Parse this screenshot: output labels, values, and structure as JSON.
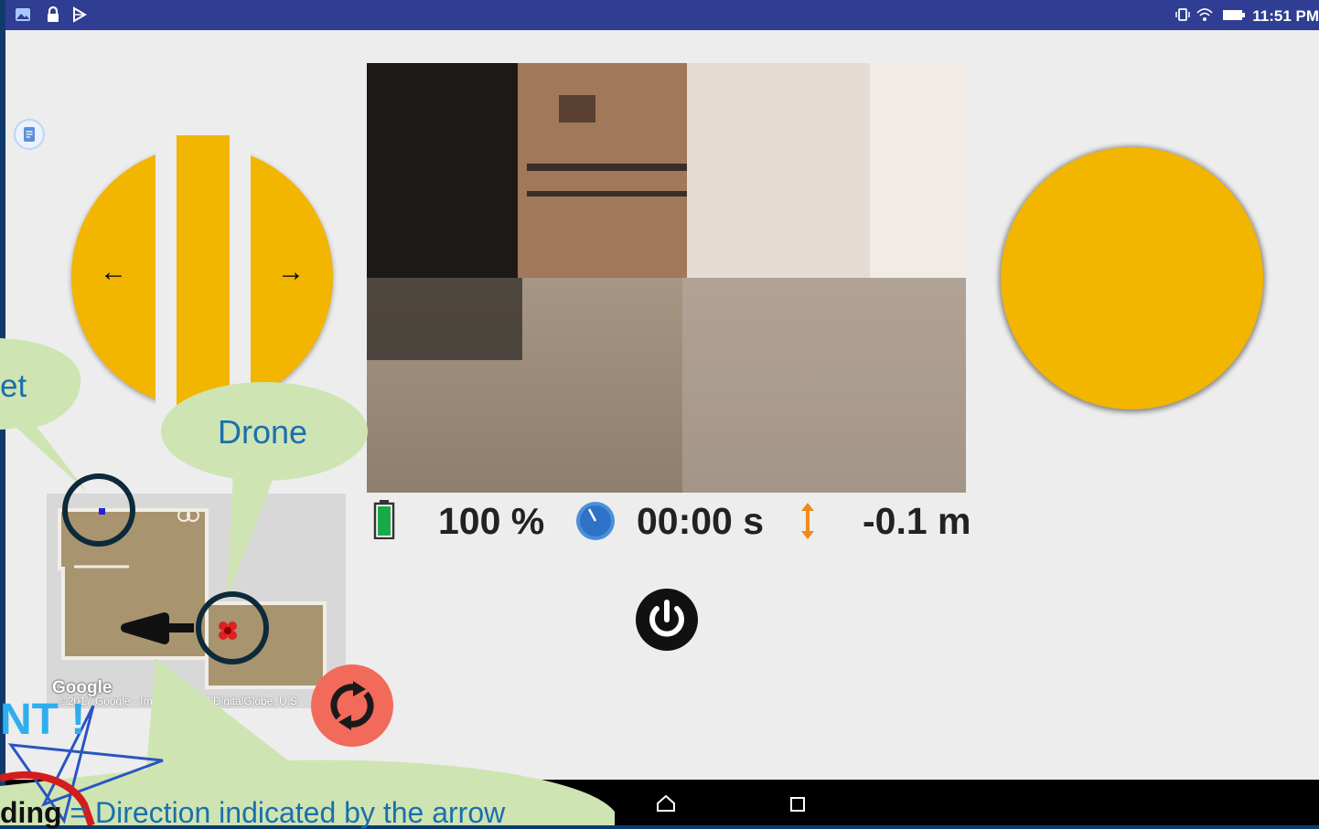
{
  "status_bar": {
    "time": "11:51 PM",
    "left_icons": [
      "gallery-icon",
      "lock-icon",
      "play-store-icon"
    ],
    "right_icons": [
      "vibrate-icon",
      "wifi-icon",
      "battery-icon"
    ]
  },
  "telemetry": {
    "battery": "100 %",
    "flight_time": "00:00 s",
    "altitude": "-0.1 m"
  },
  "map": {
    "attribution_logo": "Google",
    "copyright_left": "©2017 Google · Im",
    "copyright_right": "7 DigitalGlobe, U.S"
  },
  "annotations": {
    "drone_label": "Drone",
    "target_label_fragment": "et",
    "note_fragment": "NT !",
    "heading_bold": "ding",
    "heading_text": " = Direction indicated by the arrow"
  },
  "colors": {
    "joystick": "#f2b500",
    "status_bar": "#2f3d92",
    "callout": "#cfe4b3",
    "callout_text": "#1a6fad",
    "refresh": "#f26a5a"
  }
}
